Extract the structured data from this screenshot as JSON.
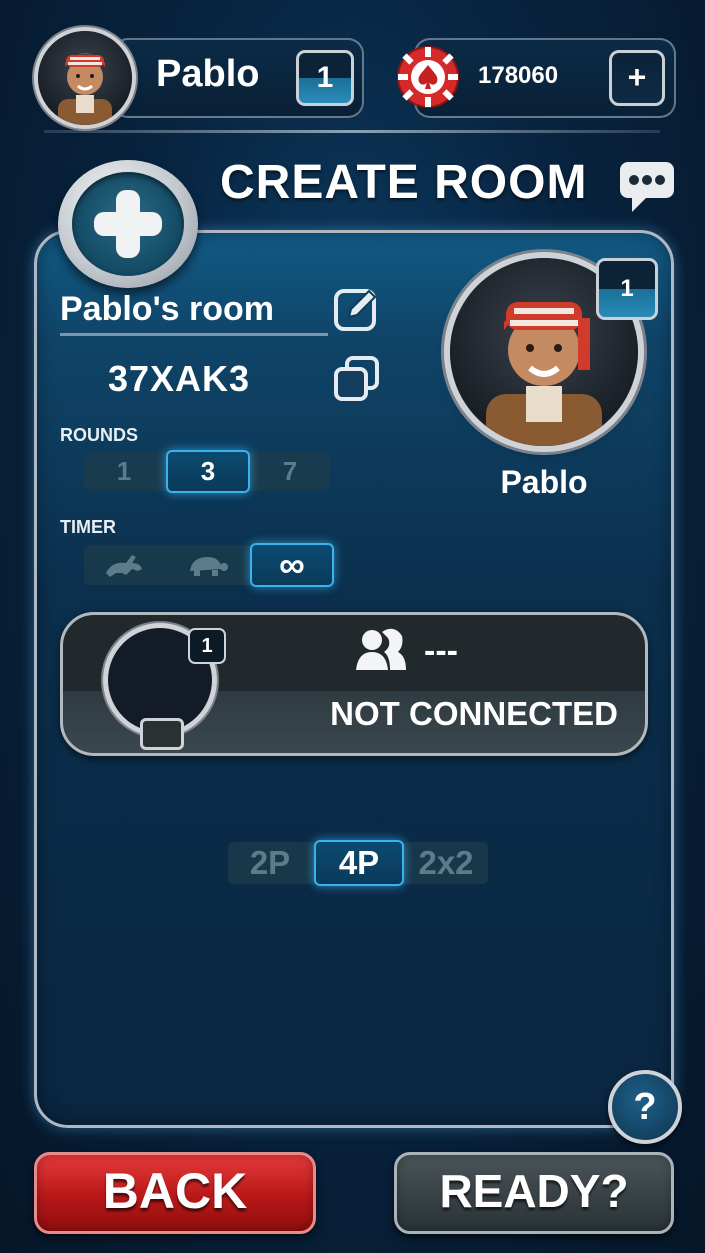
{
  "header": {
    "player_name": "Pablo",
    "player_level": "1",
    "chips": "178060",
    "add_chips_label": "+"
  },
  "title": "CREATE ROOM",
  "room": {
    "name": "Pablo's room",
    "code": "37XAK3",
    "rounds_label": "ROUNDS",
    "rounds_options": [
      "1",
      "3",
      "7"
    ],
    "rounds_selected": "3",
    "timer_label": "TIMER",
    "timer_options": [
      "rabbit-icon",
      "turtle-icon",
      "infinity-icon"
    ],
    "timer_selected": "infinity-icon",
    "timer_infinity_glyph": "∞"
  },
  "host": {
    "name": "Pablo",
    "level": "1"
  },
  "opponent_slot": {
    "level": "1",
    "name": "---",
    "status": "NOT CONNECTED"
  },
  "player_modes": {
    "options": [
      "2P",
      "4P",
      "2x2"
    ],
    "selected": "4P"
  },
  "help_label": "?",
  "buttons": {
    "back": "BACK",
    "ready": "READY?"
  },
  "colors": {
    "accent_blue": "#39b3ee",
    "back_red": "#c81e1e",
    "ready_gray": "#3a4448"
  }
}
